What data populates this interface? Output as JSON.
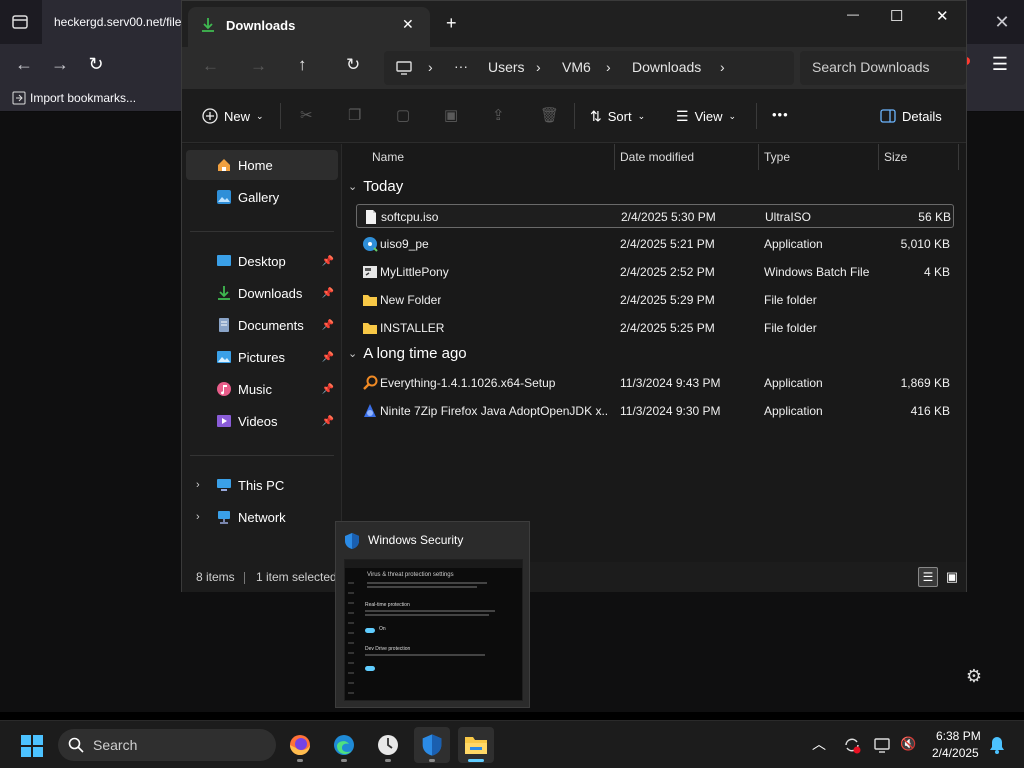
{
  "browser": {
    "tab_title": "heckergd.serv00.net/file",
    "import_bookmarks": "Import bookmarks...",
    "close_symbol": "✕"
  },
  "explorer": {
    "tab_title": "Downloads",
    "new_tab": "+",
    "window": {
      "minimize": "—",
      "maximize": "☐",
      "close": "✕"
    },
    "breadcrumb": [
      "Users",
      "VM6",
      "Downloads"
    ],
    "breadcrumb_more": "···",
    "search_placeholder": "Search Downloads",
    "toolbar": {
      "new": "New",
      "sort": "Sort",
      "view": "View",
      "more": "•••",
      "details": "Details"
    },
    "nav": {
      "pinned": [
        {
          "label": "Home",
          "icon": "home-icon"
        },
        {
          "label": "Gallery",
          "icon": "gallery-icon"
        }
      ],
      "quick": [
        {
          "label": "Desktop",
          "icon": "desktop-icon"
        },
        {
          "label": "Downloads",
          "icon": "download-icon"
        },
        {
          "label": "Documents",
          "icon": "documents-icon"
        },
        {
          "label": "Pictures",
          "icon": "pictures-icon"
        },
        {
          "label": "Music",
          "icon": "music-icon"
        },
        {
          "label": "Videos",
          "icon": "videos-icon"
        }
      ],
      "tree": [
        {
          "label": "This PC",
          "icon": "pc-icon"
        },
        {
          "label": "Network",
          "icon": "network-icon"
        }
      ]
    },
    "columns": {
      "name": "Name",
      "date": "Date modified",
      "type": "Type",
      "size": "Size"
    },
    "groups": [
      {
        "label": "Today",
        "files": [
          {
            "name": "softcpu.iso",
            "date": "2/4/2025 5:30 PM",
            "type": "UltraISO",
            "size": "56 KB",
            "icon": "file-icon",
            "selected": true
          },
          {
            "name": "uiso9_pe",
            "date": "2/4/2025 5:21 PM",
            "type": "Application",
            "size": "5,010 KB",
            "icon": "disc-app-icon"
          },
          {
            "name": "MyLittlePony",
            "date": "2/4/2025 2:52 PM",
            "type": "Windows Batch File",
            "size": "4 KB",
            "icon": "batch-file-icon"
          },
          {
            "name": "New Folder",
            "date": "2/4/2025 5:29 PM",
            "type": "File folder",
            "size": "",
            "icon": "folder-icon"
          },
          {
            "name": "INSTALLER",
            "date": "2/4/2025 5:25 PM",
            "type": "File folder",
            "size": "",
            "icon": "folder-icon"
          }
        ]
      },
      {
        "label": "A long time ago",
        "files": [
          {
            "name": "Everything-1.4.1.1026.x64-Setup",
            "date": "11/3/2024 9:43 PM",
            "type": "Application",
            "size": "1,869 KB",
            "icon": "magnifier-app-icon"
          },
          {
            "name": "Ninite 7Zip Firefox Java AdoptOpenJDK x...",
            "date": "11/3/2024 9:30 PM",
            "type": "Application",
            "size": "416 KB",
            "icon": "ninite-icon"
          }
        ]
      }
    ],
    "status": {
      "items": "8 items",
      "selected": "1 item selected"
    }
  },
  "security_popup": {
    "title": "Windows Security",
    "thumb": {
      "heading": "Virus & threat protection settings",
      "sub1": "Real-time protection",
      "sub2": "Dev Drive protection",
      "toggle_on": "On"
    }
  },
  "taskbar": {
    "search_label": "Search",
    "time": "6:38 PM",
    "date": "2/4/2025",
    "apps": [
      "firefox-icon",
      "edge-icon",
      "clock-app-icon",
      "windows-security-icon",
      "file-explorer-icon"
    ]
  },
  "colors": {
    "accent": "#60cdff",
    "folder": "#f8c846",
    "bg": "#191919"
  }
}
